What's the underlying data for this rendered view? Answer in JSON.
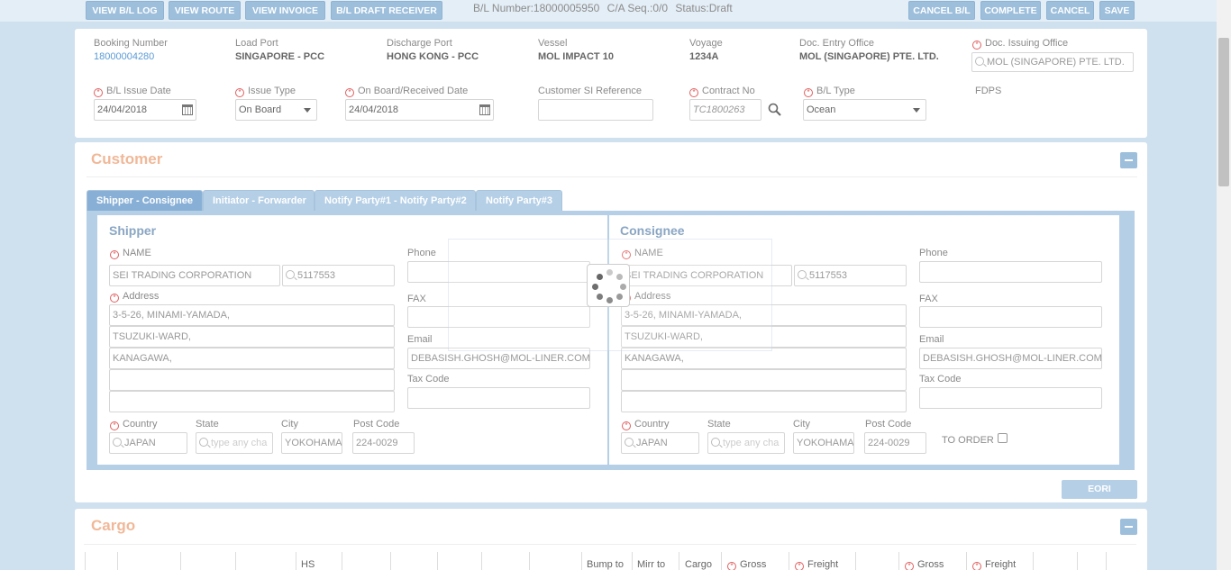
{
  "toolbar": {
    "view_bl_log": "VIEW B/L LOG",
    "view_route": "VIEW ROUTE",
    "view_invoice": "VIEW INVOICE",
    "bl_draft_receiver": "B/L DRAFT RECEIVER",
    "cancel_bl": "CANCEL B/L",
    "complete": "COMPLETE",
    "cancel": "CANCEL",
    "save": "SAVE"
  },
  "bl_info": {
    "bl_number": "B/L Number:18000005950",
    "ca_seq": "C/A Seq.:0/0",
    "status": "Status:Draft"
  },
  "header": {
    "booking_number_label": "Booking Number",
    "booking_number": "18000004280",
    "load_port_label": "Load Port",
    "load_port": "SINGAPORE - PCC",
    "discharge_port_label": "Discharge Port",
    "discharge_port": "HONG KONG - PCC",
    "vessel_label": "Vessel",
    "vessel": "MOL IMPACT 10",
    "voyage_label": "Voyage",
    "voyage": "1234A",
    "doc_entry_office_label": "Doc. Entry Office",
    "doc_entry_office": "MOL (SINGAPORE) PTE. LTD.",
    "doc_issuing_office_label": "Doc. Issuing Office",
    "doc_issuing_office": "MOL (SINGAPORE) PTE. LTD.",
    "bl_issue_date_label": "B/L Issue Date",
    "bl_issue_date": "24/04/2018",
    "issue_type_label": "Issue Type",
    "issue_type": "On Board",
    "onboard_date_label": "On Board/Received Date",
    "onboard_date": "24/04/2018",
    "customer_si_label": "Customer SI Reference",
    "customer_si": "",
    "contract_no_label": "Contract No",
    "contract_no": "TC1800263",
    "bl_type_label": "B/L Type",
    "bl_type": "Ocean",
    "fdps_label": "FDPS"
  },
  "customer": {
    "title": "Customer",
    "tabs": [
      "Shipper - Consignee",
      "Initiator - Forwarder",
      "Notify Party#1 - Notify Party#2",
      "Notify Party#3"
    ],
    "eori_label": "EORI"
  },
  "shipper": {
    "title": "Shipper",
    "name_label": "NAME",
    "name": "SEI TRADING CORPORATION",
    "code": "5117553",
    "address_label": "Address",
    "address": [
      "3-5-26, MINAMI-YAMADA,",
      "TSUZUKI-WARD,",
      "KANAGAWA,",
      "",
      ""
    ],
    "phone_label": "Phone",
    "phone": "",
    "fax_label": "FAX",
    "fax": "",
    "email_label": "Email",
    "email": "DEBASISH.GHOSH@MOL-LINER.COM",
    "tax_label": "Tax Code",
    "tax": "",
    "country_label": "Country",
    "country": "JAPAN",
    "state_label": "State",
    "state_placeholder": "type any cha",
    "city_label": "City",
    "city": "YOKOHAMA",
    "postcode_label": "Post Code",
    "postcode": "224-0029"
  },
  "consignee": {
    "title": "Consignee",
    "name_label": "NAME",
    "name": "SEI TRADING CORPORATION",
    "code": "5117553",
    "address_label": "Address",
    "address": [
      "3-5-26, MINAMI-YAMADA,",
      "TSUZUKI-WARD,",
      "KANAGAWA,",
      "",
      ""
    ],
    "phone_label": "Phone",
    "phone": "",
    "fax_label": "FAX",
    "fax": "",
    "email_label": "Email",
    "email": "DEBASISH.GHOSH@MOL-LINER.COM",
    "tax_label": "Tax Code",
    "tax": "",
    "country_label": "Country",
    "country": "JAPAN",
    "state_label": "State",
    "state_placeholder": "type any cha",
    "city_label": "City",
    "city": "YOKOHAMA",
    "postcode_label": "Post Code",
    "postcode": "224-0029",
    "to_order_label": "TO ORDER"
  },
  "cargo": {
    "title": "Cargo",
    "headers": [
      "HS",
      "Bump to",
      "Mirr to",
      "Cargo",
      "Gross",
      "Freight",
      "Gross",
      "Freight"
    ]
  }
}
